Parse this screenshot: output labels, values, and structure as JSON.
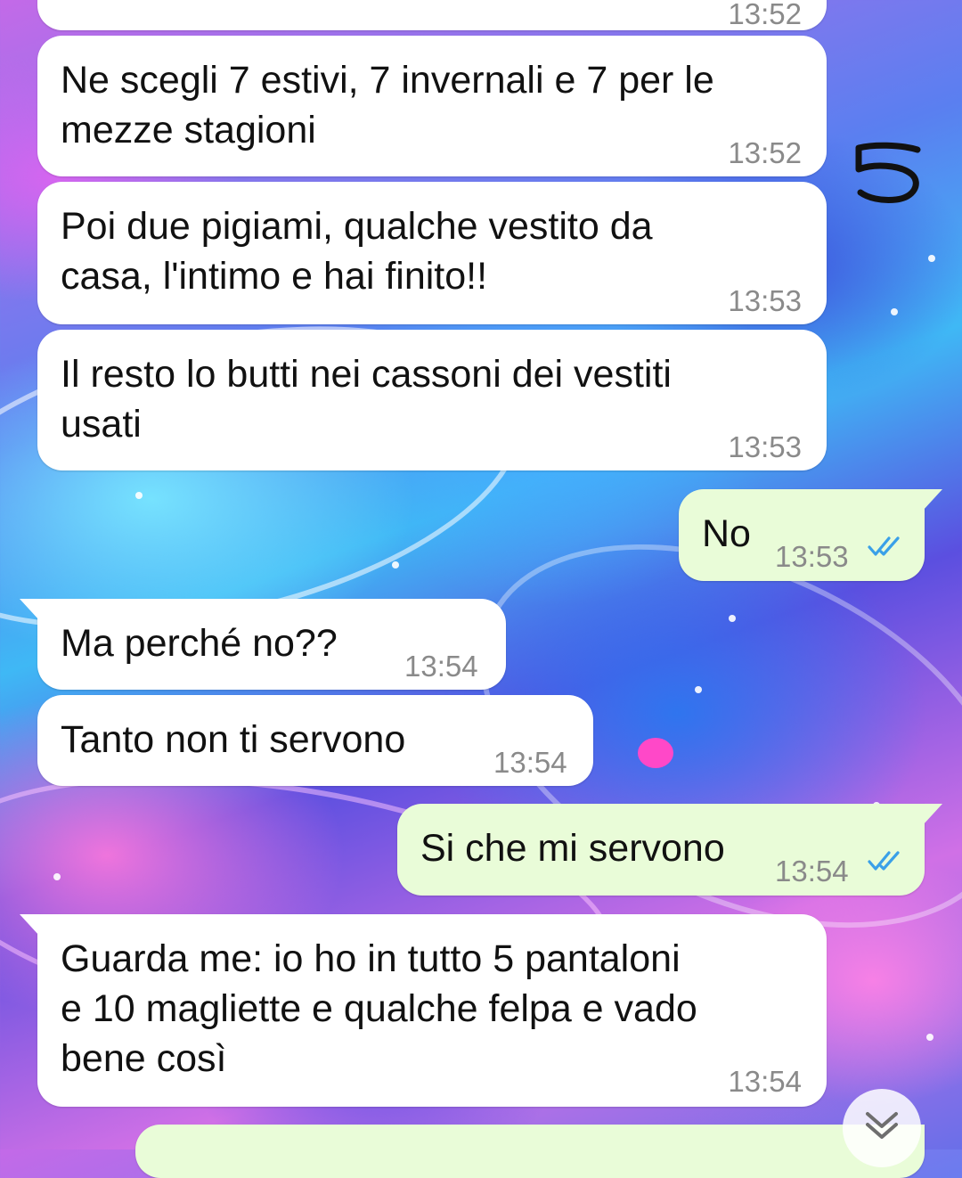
{
  "messages": [
    {
      "side": "in",
      "text": [
        "Ne scegli 7 estivi, 7 invernali e 7 per le",
        "mezze stagioni"
      ],
      "time": "13:52"
    },
    {
      "side": "in",
      "text": [
        "Poi due pigiami, qualche vestito da",
        "casa, l'intimo e hai finito!!"
      ],
      "time": "13:53"
    },
    {
      "side": "in",
      "text": [
        "Il resto lo butti nei cassoni dei vestiti",
        "usati"
      ],
      "time": "13:53"
    },
    {
      "side": "out",
      "text": [
        "No"
      ],
      "time": "13:53",
      "status": "read"
    },
    {
      "side": "in",
      "text": [
        "Ma perché no??"
      ],
      "time": "13:54"
    },
    {
      "side": "in",
      "text": [
        "Tanto non ti servono"
      ],
      "time": "13:54"
    },
    {
      "side": "out",
      "text": [
        "Si che mi servono"
      ],
      "time": "13:54",
      "status": "read"
    },
    {
      "side": "in",
      "text": [
        "Guarda me: io ho in tutto 5 pantaloni",
        "e 10 magliette e qualche felpa e vado",
        "bene così"
      ],
      "time": "13:54"
    }
  ],
  "top_partial_time": "13:52",
  "annotation": "5",
  "colors": {
    "incoming": "#ffffff",
    "outgoing": "#e9fcd8",
    "read_ticks": "#3aa0e8",
    "time": "#8a8a8a"
  },
  "icons": {
    "read_status": "double-check-icon",
    "scroll": "chevron-double-down-icon"
  }
}
